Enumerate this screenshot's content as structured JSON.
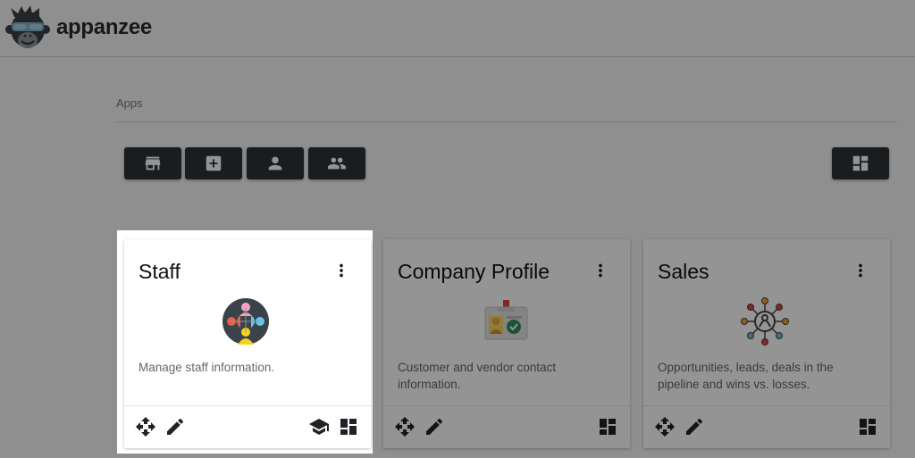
{
  "header": {
    "brand": "appanzee",
    "logo_icon": "monkey-logo-icon"
  },
  "section": {
    "label": "Apps"
  },
  "toolbar": {
    "buttons": [
      {
        "icon": "store-icon"
      },
      {
        "icon": "add-box-icon"
      },
      {
        "icon": "person-icon"
      },
      {
        "icon": "people-icon"
      }
    ],
    "layout_button": {
      "icon": "dashboard-icon"
    }
  },
  "cards": [
    {
      "title": "Staff",
      "description": "Manage staff information.",
      "icon": "staff-network-icon",
      "highlighted": true,
      "actions_left": [
        "move-icon",
        "edit-icon"
      ],
      "actions_right": [
        "school-icon",
        "dashboard-icon"
      ]
    },
    {
      "title": "Company Profile",
      "description": "Customer and vendor contact information.",
      "icon": "id-badge-icon",
      "actions_left": [
        "move-icon",
        "edit-icon"
      ],
      "actions_right": [
        "dashboard-icon"
      ]
    },
    {
      "title": "Sales",
      "description": "Opportunities, leads, deals in the pipeline and wins vs. losses.",
      "icon": "sales-network-icon",
      "actions_left": [
        "move-icon",
        "edit-icon"
      ],
      "actions_right": [
        "dashboard-icon"
      ]
    }
  ]
}
